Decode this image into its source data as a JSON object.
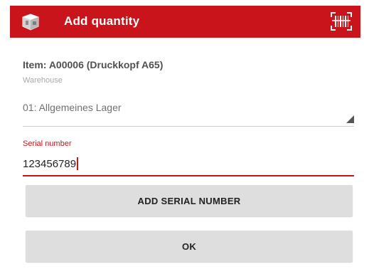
{
  "app_bar": {
    "title": "Add quantity",
    "background_color": "#c9141c",
    "app_icon": "box-app-icon",
    "action_icon": "barcode-scan-icon"
  },
  "item": {
    "title": "Item: A00006 (Druckkopf A65)"
  },
  "warehouse": {
    "label": "Warehouse",
    "selected_value": "01: Allgemeines Lager"
  },
  "serial_number": {
    "label": "Serial number",
    "value": "123456789",
    "accent_color": "#c9141c"
  },
  "buttons": {
    "add_serial_label": "ADD SERIAL NUMBER",
    "ok_label": "OK"
  }
}
